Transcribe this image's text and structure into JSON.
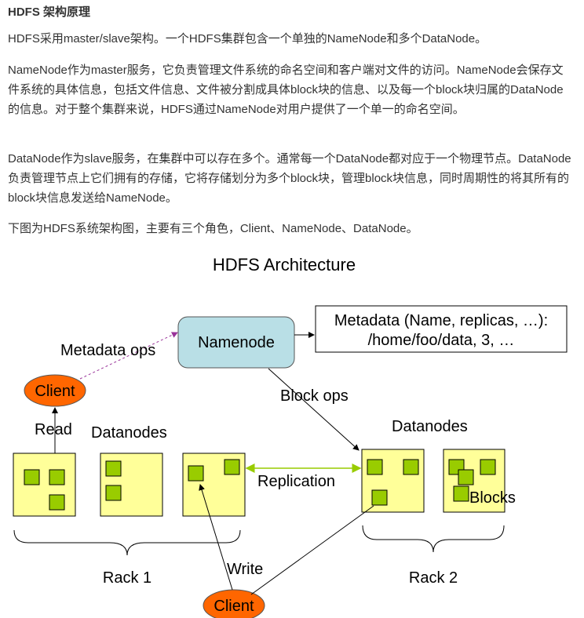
{
  "article": {
    "title": "HDFS 架构原理",
    "paragraphs": [
      "HDFS采用master/slave架构。一个HDFS集群包含一个单独的NameNode和多个DataNode。",
      "NameNode作为master服务，它负责管理文件系统的命名空间和客户端对文件的访问。NameNode会保存文件系统的具体信息，包括文件信息、文件被分割成具体block块的信息、以及每一个block块归属的DataNode的信息。对于整个集群来说，HDFS通过NameNode对用户提供了一个单一的命名空间。",
      "DataNode作为slave服务，在集群中可以存在多个。通常每一个DataNode都对应于一个物理节点。DataNode负责管理节点上它们拥有的存储，它将存储划分为多个block块，管理block块信息，同时周期性的将其所有的block块信息发送给NameNode。",
      "下图为HDFS系统架构图，主要有三个角色，Client、NameNode、DataNode。"
    ]
  },
  "diagram": {
    "title": "HDFS Architecture",
    "namenode": "Namenode",
    "metadata_line1": "Metadata (Name, replicas, …):",
    "metadata_line2": "/home/foo/data, 3, …",
    "metadata_ops": "Metadata ops",
    "block_ops": "Block ops",
    "client_top": "Client",
    "client_bottom": "Client",
    "read": "Read",
    "write": "Write",
    "replication": "Replication",
    "datanodes_left": "Datanodes",
    "datanodes_right": "Datanodes",
    "blocks": "Blocks",
    "rack1": "Rack 1",
    "rack2": "Rack 2",
    "colors": {
      "namenode_fill": "#b9dfe6",
      "datanode_fill": "#ffff99",
      "block_fill": "#99cc00",
      "client_fill": "#ff6600",
      "replication_arrow": "#99cc00",
      "metadata_ops_arrow": "#993399"
    }
  }
}
